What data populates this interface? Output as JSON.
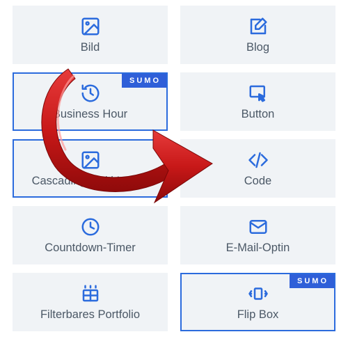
{
  "badge_text": "SUMO",
  "accent": "#2b6bdd",
  "modules": [
    {
      "id": "bild",
      "label": "Bild",
      "icon": "image",
      "selected": false,
      "badge": false
    },
    {
      "id": "blog",
      "label": "Blog",
      "icon": "edit",
      "selected": false,
      "badge": false
    },
    {
      "id": "business-hour",
      "label": "Business Hour",
      "icon": "clock-back",
      "selected": true,
      "badge": true
    },
    {
      "id": "button",
      "label": "Button",
      "icon": "cursor-box",
      "selected": false,
      "badge": false
    },
    {
      "id": "cascading-multi-image",
      "label": "Cascading Multi Image",
      "icon": "image",
      "selected": true,
      "badge": false
    },
    {
      "id": "code",
      "label": "Code",
      "icon": "code",
      "selected": false,
      "badge": false
    },
    {
      "id": "countdown-timer",
      "label": "Countdown-Timer",
      "icon": "clock",
      "selected": false,
      "badge": false
    },
    {
      "id": "email-optin",
      "label": "E-Mail-Optin",
      "icon": "mail",
      "selected": false,
      "badge": false
    },
    {
      "id": "filterbares-portfolio",
      "label": "Filterbares Portfolio",
      "icon": "grid",
      "selected": false,
      "badge": false
    },
    {
      "id": "flip-box",
      "label": "Flip Box",
      "icon": "flip",
      "selected": true,
      "badge": true
    }
  ]
}
